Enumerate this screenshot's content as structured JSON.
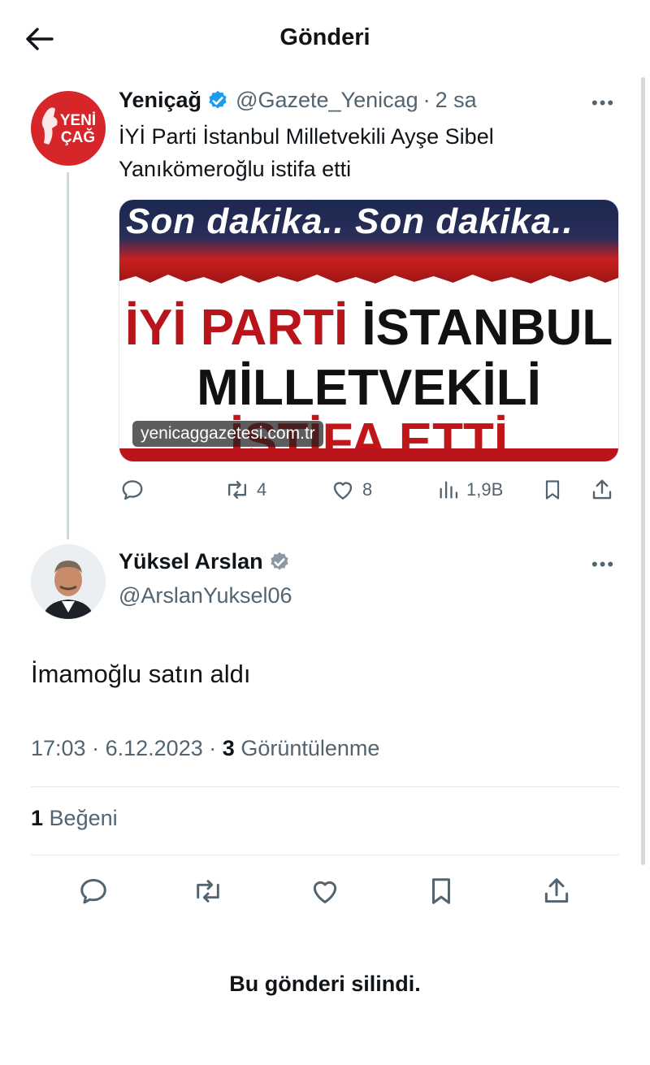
{
  "header": {
    "title": "Gönderi",
    "back_icon": "arrow-left-icon"
  },
  "quoted_tweet": {
    "author_name": "Yeniçağ",
    "handle": "@Gazete_Yenicag",
    "separator": "·",
    "time": "2 sa",
    "more": "•••",
    "text": "İYİ Parti İstanbul Milletvekili Ayşe Sibel Yanıkömeroğlu istifa etti",
    "avatar_logo_line1": "YENİ",
    "avatar_logo_line2": "ÇAĞ",
    "media": {
      "banner": "Son dakika.. Son dakika..",
      "headline_part1_red": "İYİ PARTİ",
      "headline_part1_dark": "İSTANBUL",
      "headline_line2": "MİLLETVEKİLİ",
      "headline_line3": "İSTİFA ETTİ",
      "source": "yenicaggazetesi.com.tr"
    },
    "actions": {
      "reposts": "4",
      "likes": "8",
      "views": "1,9B"
    }
  },
  "main_tweet": {
    "author_name": "Yüksel Arslan",
    "handle": "@ArslanYuksel06",
    "more": "•••",
    "text": "İmamoğlu satın aldı",
    "time": "17:03",
    "date": "6.12.2023",
    "dot": "·",
    "views_count": "3",
    "views_label": "Görüntülenme",
    "likes_count": "1",
    "likes_label": "Beğeni"
  },
  "deleted_notice": "Bu gönderi silindi.",
  "colors": {
    "verified": "#1d9bf0",
    "brand_red": "#d7262a",
    "secondary_text": "#536471"
  }
}
